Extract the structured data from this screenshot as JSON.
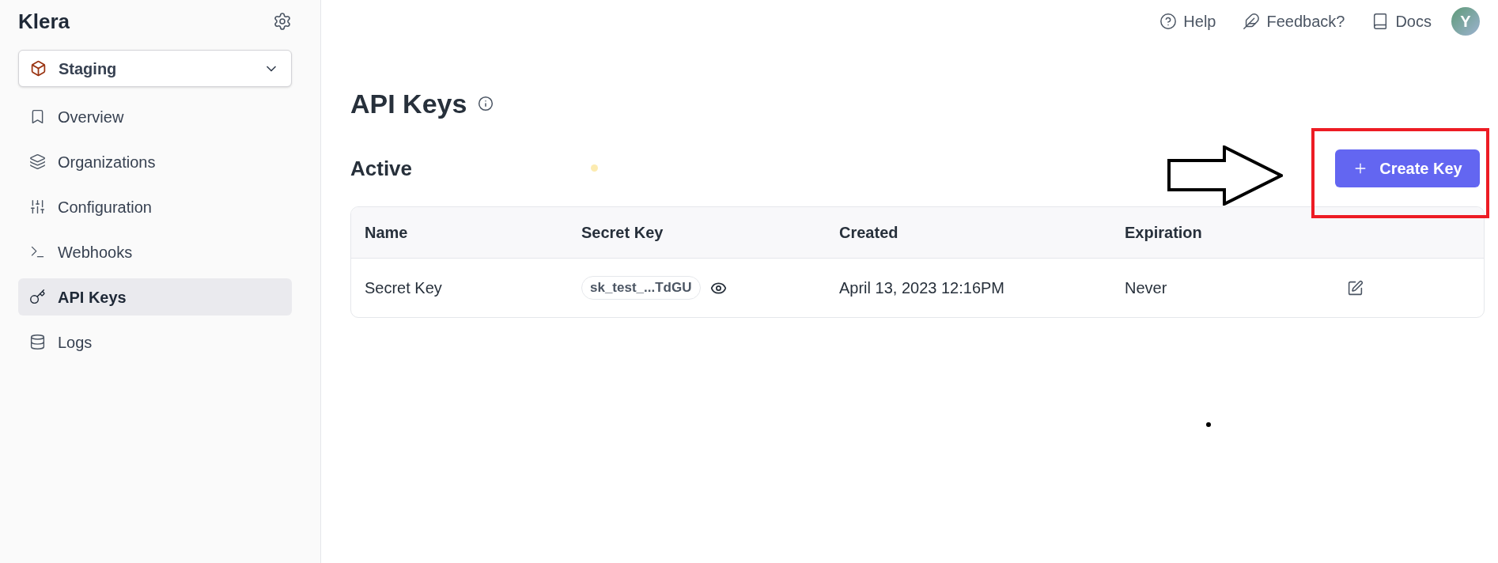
{
  "sidebar": {
    "brand": "Klera",
    "environment": {
      "label": "Staging"
    },
    "items": [
      {
        "label": "Overview",
        "selected": false
      },
      {
        "label": "Organizations",
        "selected": false
      },
      {
        "label": "Configuration",
        "selected": false
      },
      {
        "label": "Webhooks",
        "selected": false
      },
      {
        "label": "API Keys",
        "selected": true
      },
      {
        "label": "Logs",
        "selected": false
      }
    ]
  },
  "header": {
    "links": [
      {
        "label": "Help"
      },
      {
        "label": "Feedback?"
      },
      {
        "label": "Docs"
      }
    ],
    "avatar": {
      "initial": "Y"
    }
  },
  "page": {
    "title": "API Keys",
    "section": "Active",
    "create_button": "Create Key"
  },
  "table": {
    "columns": [
      "Name",
      "Secret Key",
      "Created",
      "Expiration"
    ],
    "rows": [
      {
        "name": "Secret Key",
        "secret_key": "sk_test_...TdGU",
        "created": "April 13, 2023 12:16PM",
        "expiration": "Never"
      }
    ]
  }
}
